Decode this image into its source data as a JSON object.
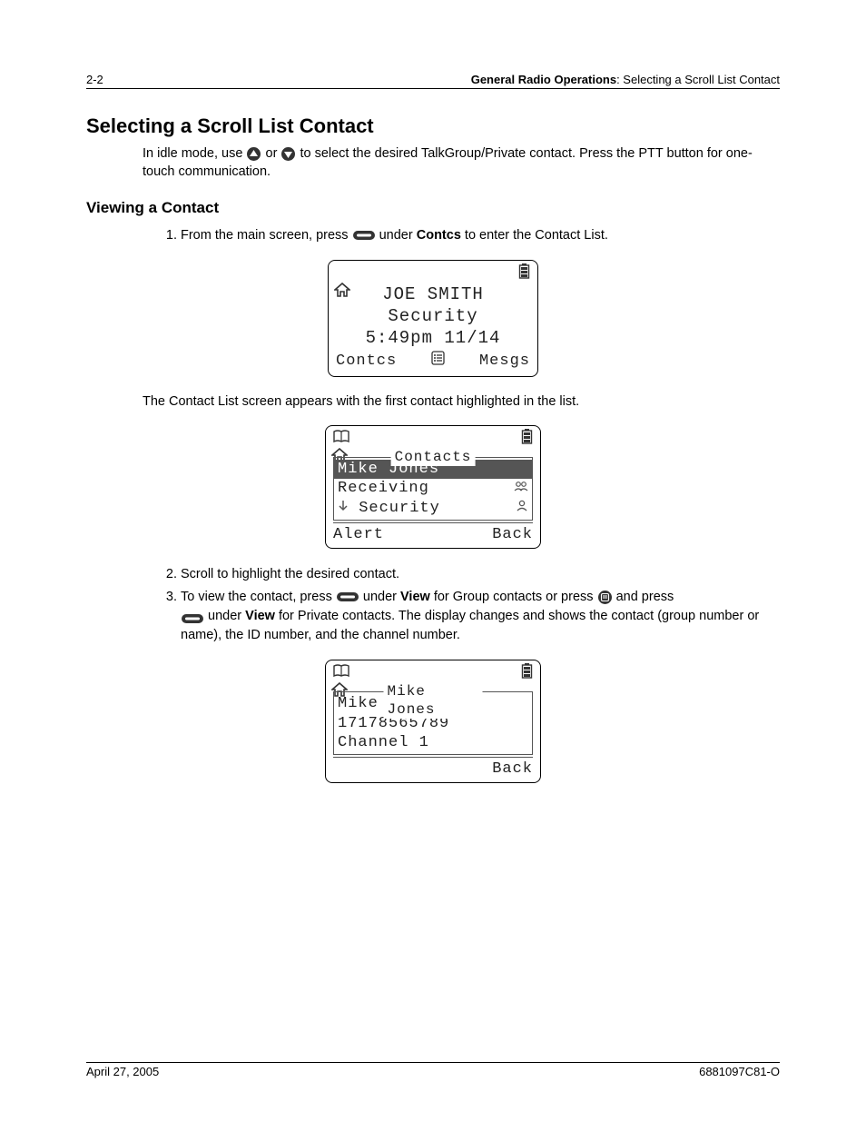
{
  "header": {
    "page_no": "2-2",
    "crumb_bold": "General Radio Operations",
    "crumb_rest": ": Selecting a Scroll List Contact"
  },
  "section_title": "Selecting a Scroll List Contact",
  "intro": {
    "pre": "In idle mode, use ",
    "mid": " or ",
    "post": " to select the desired TalkGroup/Private contact. Press the PTT button for one-touch communication."
  },
  "subhead": "Viewing a Contact",
  "steps": {
    "s1_pre": "From the main screen, press ",
    "s1_mid": " under ",
    "s1_bold": "Contcs",
    "s1_post": " to enter the Contact List.",
    "after1": "The Contact List screen appears with the first contact highlighted in the list.",
    "s2": "Scroll to highlight the desired contact.",
    "s3_a": "To view the contact, press ",
    "s3_b": " under ",
    "s3_view1": "View",
    "s3_c": " for Group contacts or press ",
    "s3_d": " and press ",
    "s3_e": " under ",
    "s3_view2": "View",
    "s3_f": " for Private contacts. The display changes and shows the contact (group number or name), the ID number, and the channel number."
  },
  "screen1": {
    "line1": "JOE SMITH",
    "line2": "Security",
    "line3": "5:49pm 11/14",
    "soft_left": "Contcs",
    "soft_right": "Mesgs"
  },
  "screen2": {
    "title": "Contacts",
    "row1": "Mike Jones",
    "row2": "Receiving",
    "row3": "Security",
    "soft_left": "Alert",
    "soft_right": "Back"
  },
  "screen3": {
    "title": "Mike Jones",
    "row1": "Mike Jones",
    "row2": "17178565789",
    "row3": "Channel 1",
    "soft_right": "Back"
  },
  "footer": {
    "date": "April 27, 2005",
    "docno": "6881097C81-O"
  }
}
